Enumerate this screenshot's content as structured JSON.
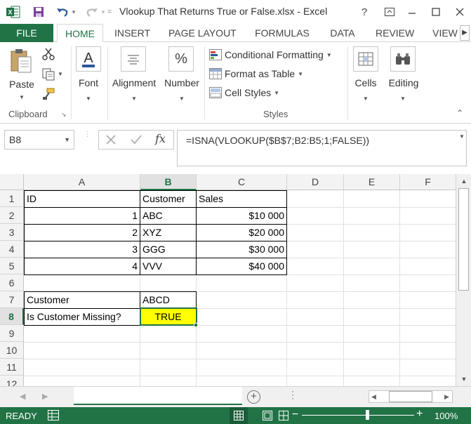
{
  "window": {
    "title": "Vlookup That Returns True or False.xlsx - Excel",
    "help": "?"
  },
  "tabs": [
    "FILE",
    "HOME",
    "INSERT",
    "PAGE LAYOUT",
    "FORMULAS",
    "DATA",
    "REVIEW",
    "VIEW"
  ],
  "ribbon": {
    "clipboard": {
      "paste": "Paste",
      "label": "Clipboard"
    },
    "font": "Font",
    "alignment": "Alignment",
    "number": "Number",
    "styles": {
      "conditional": "Conditional Formatting",
      "table": "Format as Table",
      "cell_styles": "Cell Styles",
      "label": "Styles"
    },
    "cells": "Cells",
    "editing": "Editing"
  },
  "formula_bar": {
    "name_box": "B8",
    "fx": "fx",
    "formula": "=ISNA(VLOOKUP($B$7;B2:B5;1;FALSE))"
  },
  "grid": {
    "columns": [
      "A",
      "B",
      "C",
      "D",
      "E",
      "F"
    ],
    "active_column": "B",
    "rows": [
      "1",
      "2",
      "3",
      "4",
      "5",
      "6",
      "7",
      "8",
      "9",
      "10",
      "11",
      "12"
    ],
    "active_row": "8",
    "cells": {
      "A1": "ID",
      "B1": "Customer",
      "C1": "Sales",
      "A2": "1",
      "B2": "ABC",
      "C2": "$10 000",
      "A3": "2",
      "B3": "XYZ",
      "C3": "$20 000",
      "A4": "3",
      "B4": "GGG",
      "C4": "$30 000",
      "A5": "4",
      "B5": "VVV",
      "C5": "$40 000",
      "A7": "Customer",
      "B7": "ABCD",
      "A8": "Is Customer Missing?",
      "B8": "TRUE"
    },
    "highlight_color": "#ffff00",
    "accent_color": "#217346"
  },
  "status": {
    "ready": "READY",
    "zoom": "100%",
    "zoom_minus": "−",
    "zoom_plus": "+",
    "add_sheet": "+"
  }
}
